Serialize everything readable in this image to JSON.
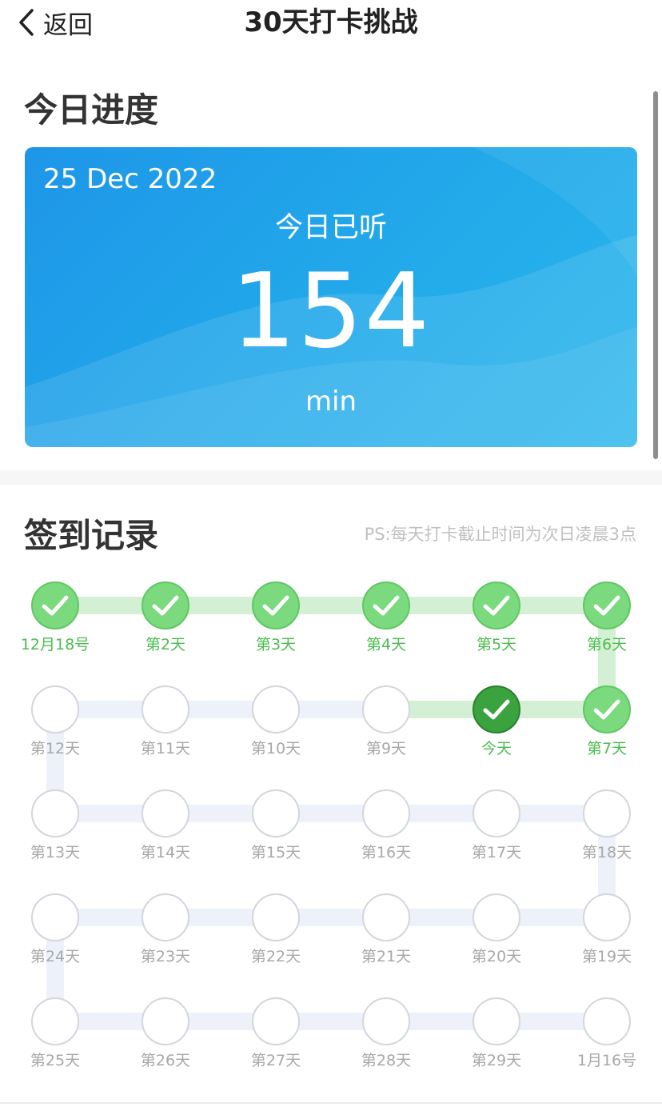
{
  "nav": {
    "back_label": "返回",
    "title": "30天打卡挑战"
  },
  "today": {
    "section_title": "今日进度",
    "date": "25 Dec 2022",
    "label": "今日已听",
    "value": "154",
    "unit": "min"
  },
  "records": {
    "section_title": "签到记录",
    "hint": "PS:每天打卡截止时间为次日凌晨3点",
    "days": [
      {
        "label": "12月18号",
        "status": "done"
      },
      {
        "label": "第2天",
        "status": "done"
      },
      {
        "label": "第3天",
        "status": "done"
      },
      {
        "label": "第4天",
        "status": "done"
      },
      {
        "label": "第5天",
        "status": "done"
      },
      {
        "label": "第6天",
        "status": "done"
      },
      {
        "label": "第7天",
        "status": "done"
      },
      {
        "label": "今天",
        "status": "today"
      },
      {
        "label": "第9天",
        "status": "none"
      },
      {
        "label": "第10天",
        "status": "none"
      },
      {
        "label": "第11天",
        "status": "none"
      },
      {
        "label": "第12天",
        "status": "none"
      },
      {
        "label": "第13天",
        "status": "none"
      },
      {
        "label": "第14天",
        "status": "none"
      },
      {
        "label": "第15天",
        "status": "none"
      },
      {
        "label": "第16天",
        "status": "none"
      },
      {
        "label": "第17天",
        "status": "none"
      },
      {
        "label": "第18天",
        "status": "none"
      },
      {
        "label": "第19天",
        "status": "none"
      },
      {
        "label": "第20天",
        "status": "none"
      },
      {
        "label": "第21天",
        "status": "none"
      },
      {
        "label": "第22天",
        "status": "none"
      },
      {
        "label": "第23天",
        "status": "none"
      },
      {
        "label": "第24天",
        "status": "none"
      },
      {
        "label": "第25天",
        "status": "none"
      },
      {
        "label": "第26天",
        "status": "none"
      },
      {
        "label": "第27天",
        "status": "none"
      },
      {
        "label": "第28天",
        "status": "none"
      },
      {
        "label": "第29天",
        "status": "none"
      },
      {
        "label": "1月16号",
        "status": "none"
      }
    ]
  },
  "colors": {
    "card_blue": "#1e96e8",
    "done_green": "#7bd97e",
    "today_green": "#3aa33e",
    "path_green": "#d4f0d4",
    "path_gray": "#edf1fa"
  }
}
